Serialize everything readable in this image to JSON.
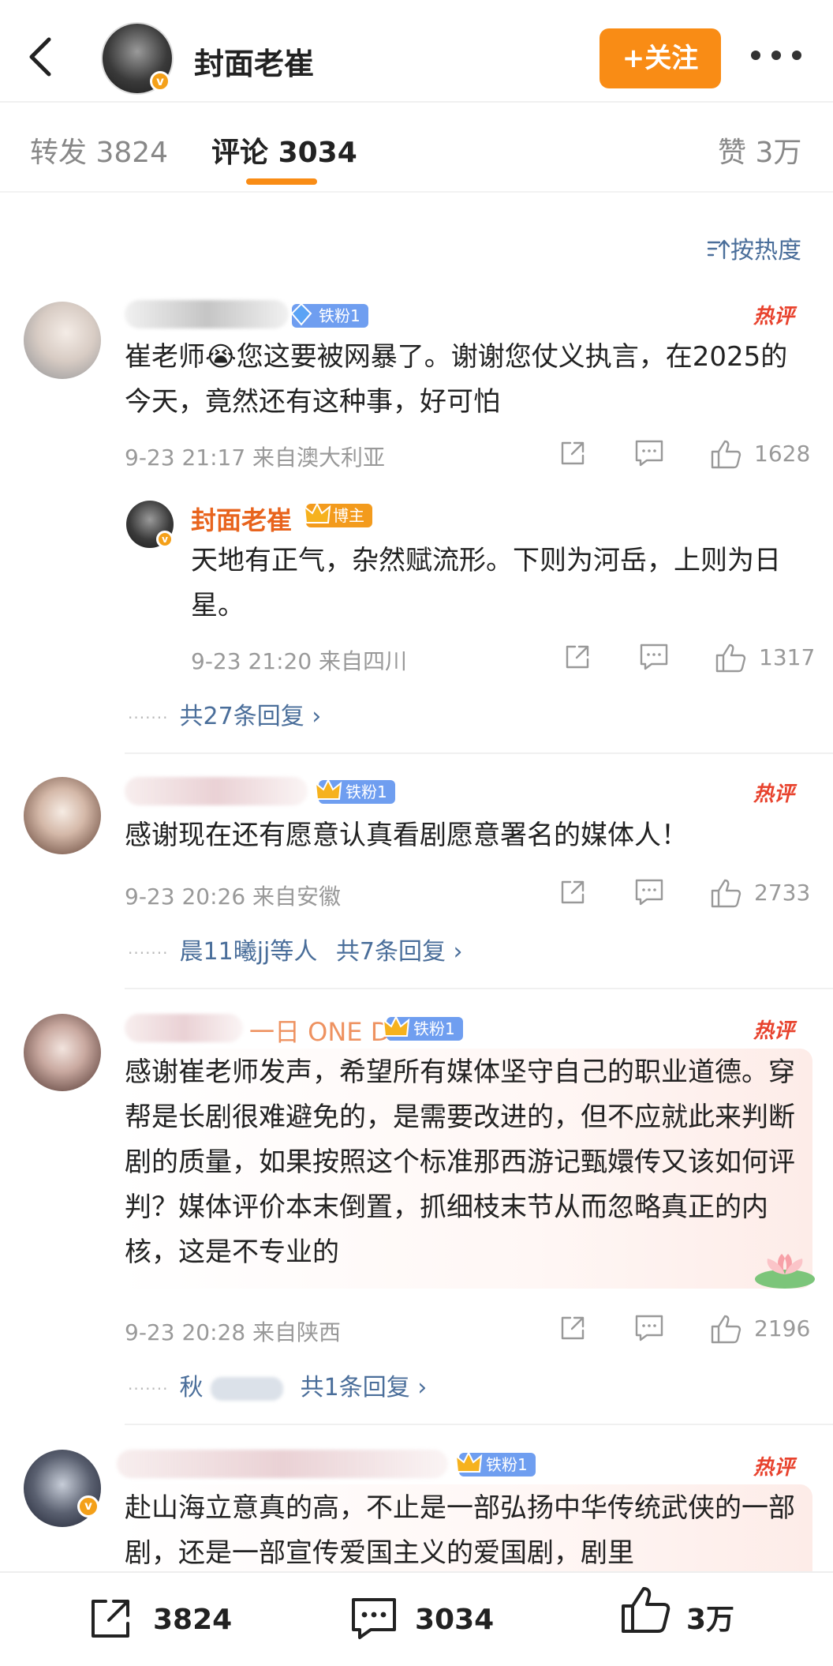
{
  "header": {
    "author_name": "封面老崔",
    "follow_label": "+关注",
    "verified_mark": "v"
  },
  "tabs": {
    "repost_label": "转发",
    "repost_count": "3824",
    "comment_label": "评论",
    "comment_count": "3034",
    "like_label": "赞",
    "like_count": "3万"
  },
  "sort_label": "按热度",
  "hot_label": "热评",
  "comments": [
    {
      "badge": "铁粉1",
      "text": "崔老师😭您这要被网暴了。谢谢您仗义执言，在2025的今天，竟然还有这种事，好可怕",
      "time": "9-23 21:17",
      "location": "来自澳大利亚",
      "likes": "1628",
      "reply": {
        "name": "封面老崔",
        "badge": "博主",
        "text": "天地有正气，杂然赋流形。下则为河岳，上则为日星。",
        "time": "9-23 21:20",
        "location": "来自四川",
        "likes": "1317"
      },
      "reply_summary": "共27条回复 ›"
    },
    {
      "badge": "铁粉1",
      "text": "感谢现在还有愿意认真看剧愿意署名的媒体人！",
      "time": "9-23 20:26",
      "location": "来自安徽",
      "likes": "2733",
      "reply_users": "晨11曦jj等人",
      "reply_summary": "共7条回复 ›"
    },
    {
      "name_partial": "一日 ONE DAY",
      "badge": "铁粉1",
      "text": "感谢崔老师发声，希望所有媒体坚守自己的职业道德。穿帮是长剧很难避免的，是需要改进的，但不应就此来判断剧的质量，如果按照这个标准那西游记甄嬛传又该如何评判？媒体评价本末倒置，抓细枝末节从而忽略真正的内核，这是不专业的",
      "time": "9-23 20:28",
      "location": "来自陕西",
      "likes": "2196",
      "reply_users_partial": "秋",
      "reply_summary": "共1条回复 ›"
    },
    {
      "badge": "铁粉1",
      "text": "赴山海立意真的高，不止是一部弘扬中华传统武侠的一部剧，还是一部宣传爱国主义的爱国剧，剧里"
    }
  ],
  "bottom_bar": {
    "repost_count": "3824",
    "comment_count": "3034",
    "like_count": "3万"
  },
  "icons": [
    "back-icon",
    "more-icon",
    "share-icon",
    "comment-icon",
    "like-icon",
    "sort-icon"
  ],
  "colors": {
    "accent": "#f98c15",
    "link": "#4a6e9a",
    "hot": "#e8432e",
    "fan_badge": "#6f9ef0"
  }
}
